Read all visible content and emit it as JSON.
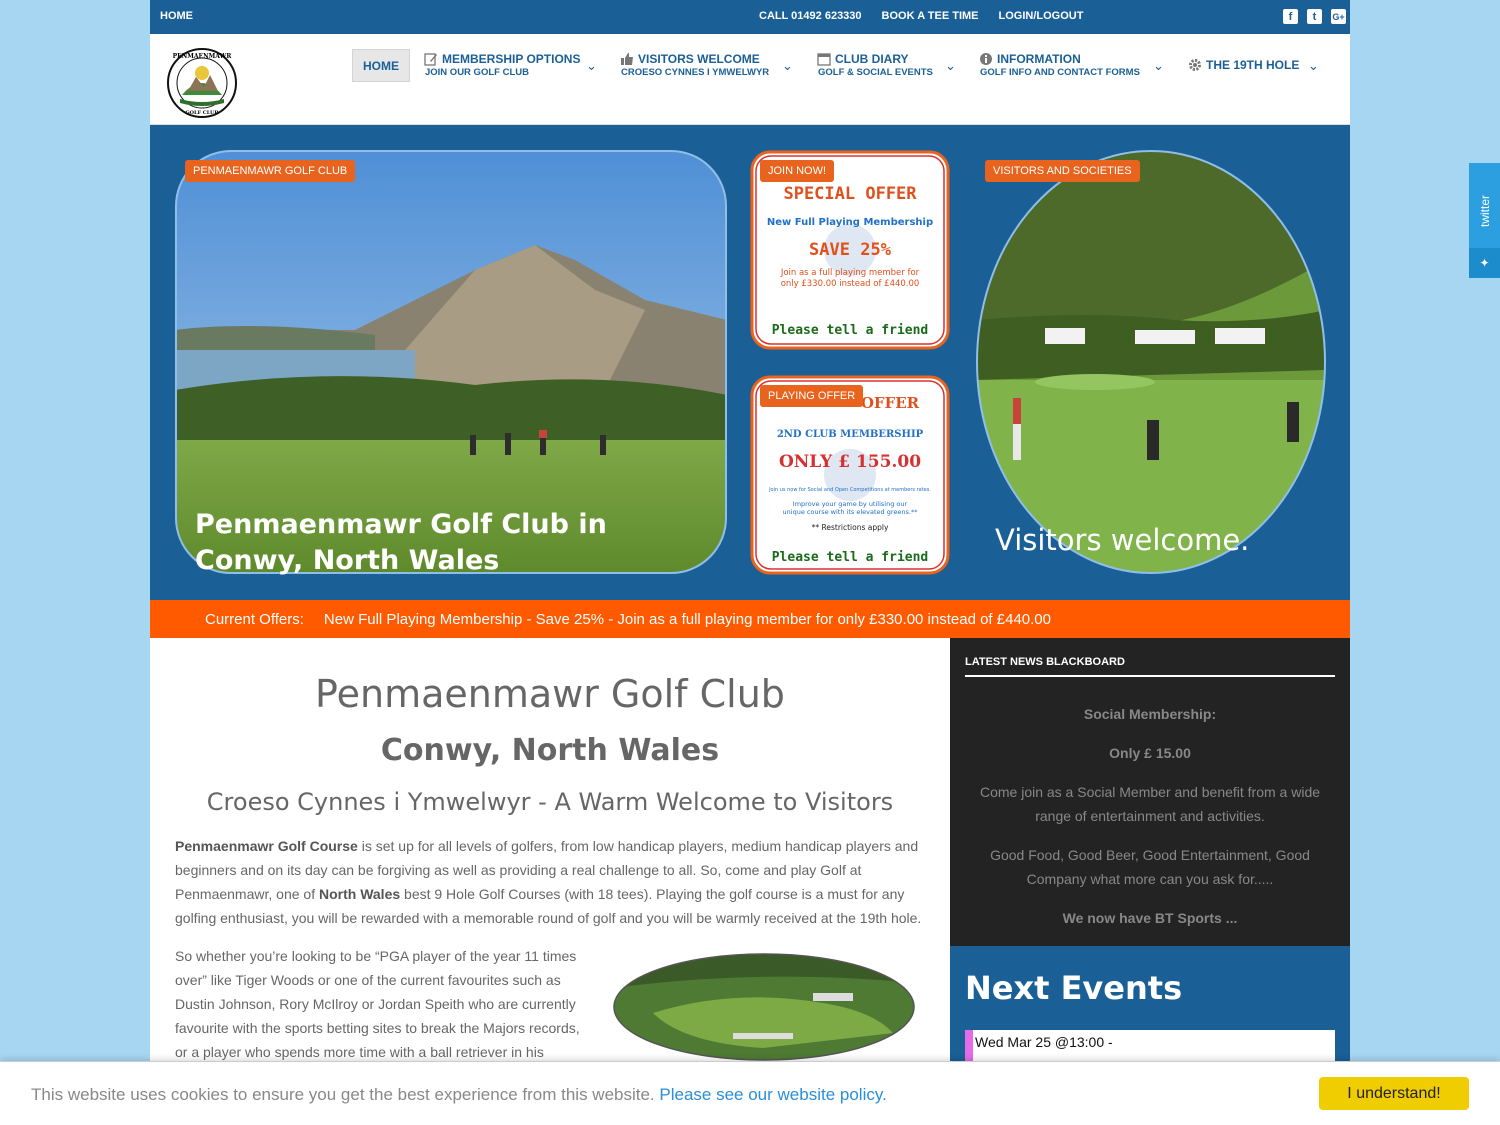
{
  "topbar": {
    "home": "HOME",
    "call": "CALL 01492 623330",
    "book": "BOOK A TEE TIME",
    "login": "LOGIN/LOGOUT",
    "social": [
      "f",
      "t",
      "G+"
    ]
  },
  "nav": {
    "home": "HOME",
    "items": [
      {
        "title": "MEMBERSHIP OPTIONS",
        "sub": "JOIN OUR GOLF CLUB"
      },
      {
        "title": "VISITORS WELCOME",
        "sub": "CROESO CYNNES I YMWELWYR"
      },
      {
        "title": "CLUB DIARY",
        "sub": "GOLF & SOCIAL EVENTS"
      },
      {
        "title": "INFORMATION",
        "sub": "GOLF INFO AND CONTACT FORMS"
      },
      {
        "title": "THE 19TH HOLE",
        "sub": ""
      }
    ],
    "chevron": "⌄"
  },
  "logo": {
    "top_text": "PENMAENMAWR",
    "bottom_text": "GOLF CLUB"
  },
  "hero": {
    "tag1": "PENMAENMAWR GOLF CLUB",
    "caption1": "Penmaenmawr Golf Club in Conwy, North Wales",
    "tag2": "JOIN NOW!",
    "offer1": {
      "title": "SPECIAL OFFER",
      "line1": "New Full Playing Membership",
      "save": "SAVE 25%",
      "note1": "Join as a full playing member for",
      "note2": "only £330.00 instead of £440.00",
      "tell": "Please tell a friend"
    },
    "tag3": "PLAYING OFFER",
    "offer2": {
      "title": "OFFER",
      "line1": "2ND CLUB MEMBERSHIP",
      "price": "ONLY £ 155.00",
      "small1": "Join us now for Social and Open Competitions at members rates.",
      "small2": "Improve your game by utilising our",
      "small3": "unique course with its elevated greens.**",
      "restrict": "** Restrictions apply",
      "tell": "Please tell a friend"
    },
    "tag4": "VISITORS AND SOCIETIES",
    "caption2": "Visitors welcome."
  },
  "ticker": {
    "label": "Current Offers:",
    "message": "New Full Playing Membership - Save 25% - Join as a full playing member for only £330.00 instead of £440.00"
  },
  "main": {
    "h1": "Penmaenmawr Golf Club",
    "h2": "Conwy, North Wales",
    "h3": "Croeso Cynnes i Ymwelwyr - A Warm Welcome to Visitors",
    "p1_b1": "Penmaenmawr Golf Course",
    "p1_t1": " is set up for all levels of golfers, from low handicap players, medium handicap players and beginners and on its day can be forgiving as well as providing a real challenge to all. So, come and play Golf at Penmaenmawr, one of ",
    "p1_b2": "North Wales",
    "p1_t2": " best 9 Hole Golf Courses (with 18 tees). Playing the golf course is a must for any golfing enthusiast, you will be rewarded with a memorable round of golf and you will be warmly received at the 19th hole.",
    "p2": "So whether you’re looking to be “PGA player of the year 11 times over” like Tiger Woods or one of the current favourites such as Dustin Johnson, Rory McIlroy or Jordan Speith who are currently favourite with the sports betting sites to break the Majors records, or a player who spends more time with a ball retriever in his hands than"
  },
  "sidebar": {
    "title": "LATEST NEWS BLACKBOARD",
    "p1": "Social Membership:",
    "p2": "Only £ 15.00",
    "p3": "Come join as a Social Member and benefit from a wide range of entertainment and activities.",
    "p4": "Good Food, Good Beer, Good Entertainment, Good Company what more can you ask for.....",
    "p5": "We now have BT Sports ...",
    "next_events": "Next Events",
    "event1": "Wed Mar 25 @13:00 -"
  },
  "twitter": {
    "label": "twitter",
    "icon": "✦"
  },
  "cookie": {
    "text": "This website uses cookies to ensure you get the best experience from this website. ",
    "link": "Please see our website policy.",
    "button": "I understand!"
  },
  "colors": {
    "brand_blue": "#1b5f97",
    "accent_orange": "#ff5a00",
    "tag_orange": "#e8641e",
    "cookie_yellow": "#f0cd00"
  }
}
